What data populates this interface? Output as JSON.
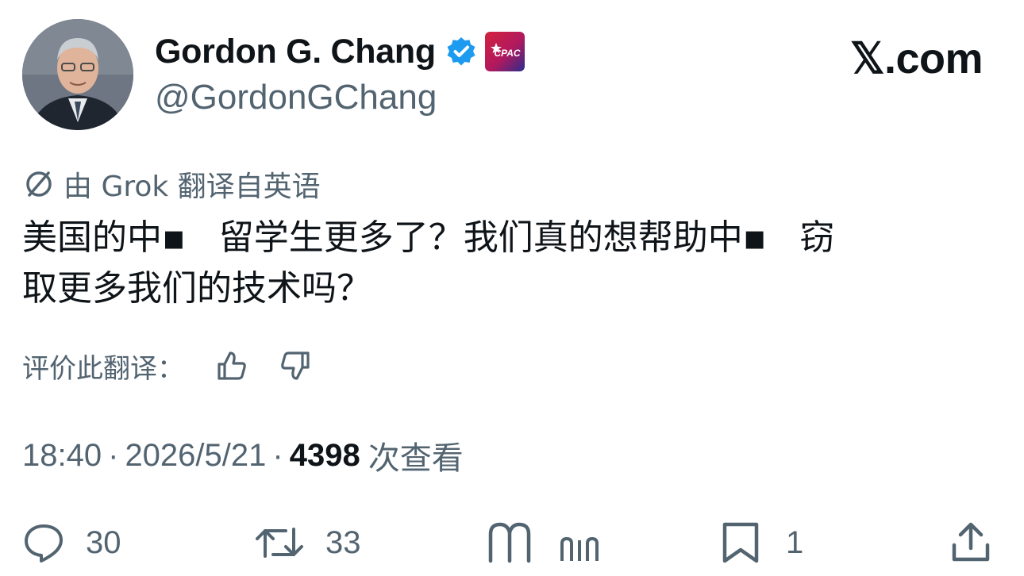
{
  "author": {
    "display_name": "Gordon G. Chang",
    "handle": "@GordonGChang"
  },
  "brand": {
    "wordmark": "𝕏.com"
  },
  "translation": {
    "label": "由 Grok 翻译自英语",
    "icon": "slash-icon"
  },
  "tweet": {
    "text": "美国的中▪   留学生更多了？我们真的想帮助中▪   窃\n取更多我们的技术吗？"
  },
  "rate_translation": {
    "label": "评价此翻译：",
    "like_icon": "thumbs-up-icon",
    "dislike_icon": "thumbs-down-icon"
  },
  "meta": {
    "time": "18:40",
    "separator": "·",
    "date": "2026/5/21",
    "views_count": "4398",
    "views_label": "次查看"
  },
  "actions": {
    "reply_count": "30",
    "repost_count": "33",
    "like_count": "",
    "bookmark_count": "1"
  },
  "colors": {
    "text_primary": "#0f1419",
    "text_secondary": "#536471",
    "verified_blue": "#1d9bf0"
  }
}
